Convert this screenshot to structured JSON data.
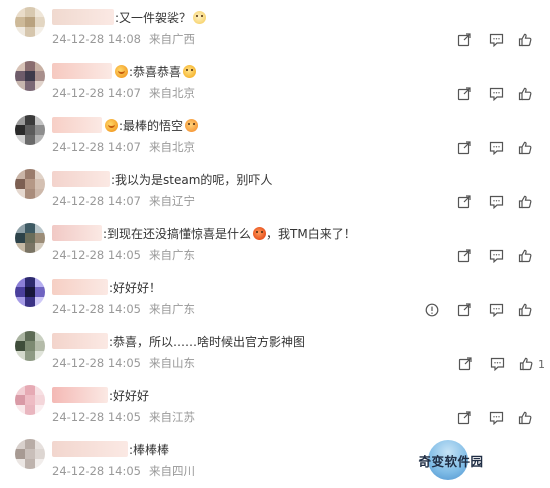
{
  "comments": [
    {
      "text": ":又一件袈裟？",
      "emoji": "cat-face",
      "badge": false,
      "time": "24-12-28 14:08",
      "source": "来自广西",
      "like_count": "",
      "actions": [
        "share-icon",
        "comment-icon",
        "like-icon"
      ],
      "avatar": [
        "#e9dcc9",
        "#d8c9b0",
        "#efe6d8",
        "#cdb998",
        "#b9a27f",
        "#e3d6c2",
        "#efe9df",
        "#d6c6ad",
        "#f4efe7"
      ],
      "username_color": "#f0d9cf"
    },
    {
      "text": ":恭喜恭喜",
      "emoji": "party-face",
      "badge": true,
      "time": "24-12-28 14:07",
      "source": "来自北京",
      "like_count": "",
      "actions": [
        "share-icon",
        "comment-icon",
        "like-icon"
      ],
      "avatar": [
        "#d7c2b6",
        "#8a6d6f",
        "#c8b1a4",
        "#6e5c6a",
        "#3e3a4a",
        "#a88f8c",
        "#c7b6ae",
        "#7b6875",
        "#e1d3cb"
      ],
      "username_color": "#f6c9c0"
    },
    {
      "text": ":最棒的悟空",
      "emoji": "love-face",
      "badge": true,
      "time": "24-12-28 14:07",
      "source": "来自北京",
      "like_count": "",
      "actions": [
        "share-icon",
        "comment-icon",
        "like-icon"
      ],
      "avatar": [
        "#9a9a9a",
        "#3b3b3b",
        "#c4c4c4",
        "#2a2a2a",
        "#5b5b5b",
        "#8d8d8d",
        "#d0d0d0",
        "#6a6a6a",
        "#b5b5b5"
      ],
      "username_color": "#f7cfc6"
    },
    {
      "text": ":我以为是steam的呢，别吓人",
      "emoji": "",
      "badge": false,
      "time": "24-12-28 14:07",
      "source": "来自辽宁",
      "like_count": "",
      "actions": [
        "share-icon",
        "comment-icon",
        "like-icon"
      ],
      "avatar": [
        "#c9b4a6",
        "#9a7c6c",
        "#e0d2c7",
        "#7c5f52",
        "#b59886",
        "#d4c0b2",
        "#e5d8cf",
        "#a98c7b",
        "#cdb8aa"
      ],
      "username_color": "#f3d3cc"
    },
    {
      "text": ":到现在还没搞懂惊喜是什么",
      "text_after": "，我TM白来了！",
      "emoji": "angry-face",
      "badge": false,
      "time": "24-12-28 14:05",
      "source": "来自广东",
      "like_count": "",
      "actions": [
        "share-icon",
        "comment-icon",
        "like-icon"
      ],
      "avatar": [
        "#8fa1a8",
        "#3e5a63",
        "#b8c5c9",
        "#2c4249",
        "#6a6d5a",
        "#9b8c77",
        "#c4b8a4",
        "#7a7464",
        "#d3cbbd"
      ],
      "username_color": "#f1c9c5"
    },
    {
      "text": ":好好好！",
      "emoji": "",
      "badge": false,
      "time": "24-12-28 14:05",
      "source": "来自广东",
      "like_count": "",
      "actions": [
        "report-icon",
        "share-icon",
        "comment-icon",
        "like-icon"
      ],
      "avatar": [
        "#8b7fd6",
        "#2d2a6e",
        "#b5aef0",
        "#4a3f9c",
        "#17163a",
        "#6f63c1",
        "#a59be6",
        "#3b3385",
        "#cfc9f7"
      ],
      "username_color": "#f6cfc4"
    },
    {
      "text": ":恭喜，所以……啥时候出官方影神图",
      "emoji": "",
      "badge": false,
      "time": "24-12-28 14:05",
      "source": "来自山东",
      "like_count": "1",
      "actions": [
        "share-icon",
        "comment-icon",
        "like-icon"
      ],
      "avatar": [
        "#a9b3a0",
        "#5d6b55",
        "#c9d0c1",
        "#3f4d3a",
        "#7d8a72",
        "#b4bba9",
        "#d4d9cc",
        "#8e9a84",
        "#e0e4da"
      ],
      "username_color": "#f3d4cb"
    },
    {
      "text": ":好好好",
      "emoji": "",
      "badge": false,
      "time": "24-12-28 14:05",
      "source": "来自江苏",
      "like_count": "",
      "actions": [
        "share-icon",
        "comment-icon",
        "like-icon"
      ],
      "avatar": [
        "#f2cfd4",
        "#e6aab4",
        "#f7e0e3",
        "#d99aa6",
        "#eebcc4",
        "#f4d6da",
        "#f9e8ea",
        "#e9b6bf",
        "#fbeef0"
      ],
      "username_color": "#f4b9b5"
    },
    {
      "text": ":棒棒棒",
      "emoji": "",
      "badge": false,
      "time": "24-12-28 14:05",
      "source": "来自四川",
      "like_count": "",
      "actions": [],
      "avatar": [
        "#d8d0cc",
        "#b8aca6",
        "#e6e0dd",
        "#a79a93",
        "#c9bfba",
        "#ddd6d2",
        "#ebe6e3",
        "#beb3ad",
        "#f1edeb"
      ],
      "username_color": "#f2d6ce"
    }
  ],
  "watermark": {
    "text": "奇变软件园"
  },
  "colors": {
    "meta": "#999999",
    "text": "#333333",
    "icon": "#555555"
  }
}
